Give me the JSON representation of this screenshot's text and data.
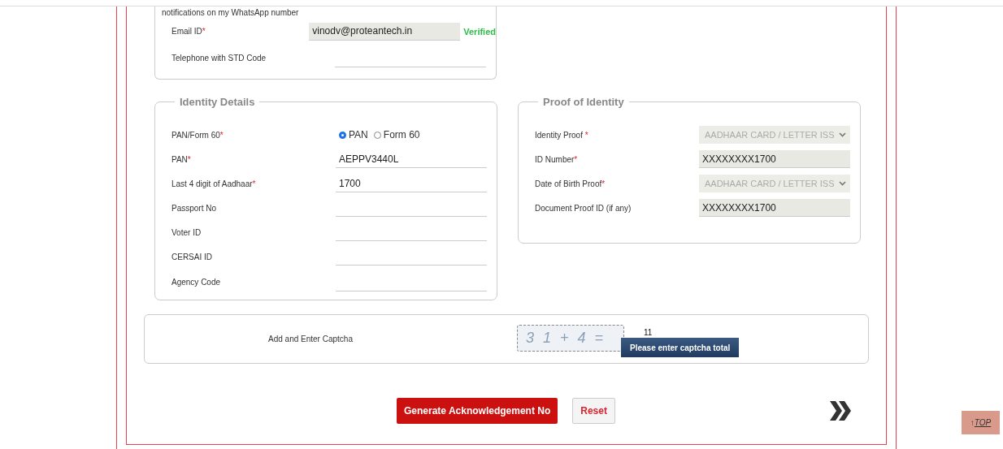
{
  "contact": {
    "consent_text": "notifications on my WhatsApp number",
    "rows": [
      {
        "label": "Email ID",
        "mark": "*",
        "value": "vinodv@proteantech.in",
        "status": "Verified",
        "kind": "readonly"
      },
      {
        "label": "Telephone with STD Code",
        "kind": "text"
      }
    ]
  },
  "identity_details": {
    "legend": "Identity Details",
    "rows": [
      {
        "label": "PAN/Form 60",
        "mark": "*",
        "kind": "radio",
        "options": [
          {
            "label": "PAN",
            "selected": true
          },
          {
            "label": "Form 60",
            "selected": false
          }
        ]
      },
      {
        "label": "PAN",
        "mark": "*",
        "kind": "text",
        "value": "AEPPV3440L"
      },
      {
        "label": "Last 4 digit of Aadhaar",
        "mark": "*",
        "kind": "text",
        "value": "1700"
      },
      {
        "label": "Passport No",
        "kind": "text"
      },
      {
        "label": "Voter ID",
        "kind": "text"
      },
      {
        "label": "CERSAI ID",
        "kind": "text"
      },
      {
        "label": "Agency Code",
        "kind": "text"
      }
    ]
  },
  "proof_of_identity": {
    "legend": "Proof of Identity",
    "rows": [
      {
        "label": "Identity Proof",
        "mark": "*",
        "kind": "select",
        "value": "AADHAAR CARD / LETTER ISS"
      },
      {
        "label": "ID Number",
        "mark": "*",
        "kind": "readonly",
        "value": "XXXXXXXX1700"
      },
      {
        "label": "Date of Birth Proof",
        "mark": "*",
        "kind": "select",
        "value": "AADHAAR CARD / LETTER ISS"
      },
      {
        "label": "Document Proof ID (if any)",
        "kind": "readonly",
        "value": "XXXXXXXX1700"
      }
    ]
  },
  "captcha": {
    "label": "Add and Enter Captcha",
    "image_text": "3 1 + 4 =",
    "value": "11",
    "tooltip": "Please enter captcha total"
  },
  "buttons": [
    {
      "label": "Generate Acknowledgement No",
      "kind": "primary"
    },
    {
      "label": "Reset",
      "kind": "secondary"
    }
  ],
  "top_link": {
    "arrow": "↑",
    "label": "TOP"
  }
}
